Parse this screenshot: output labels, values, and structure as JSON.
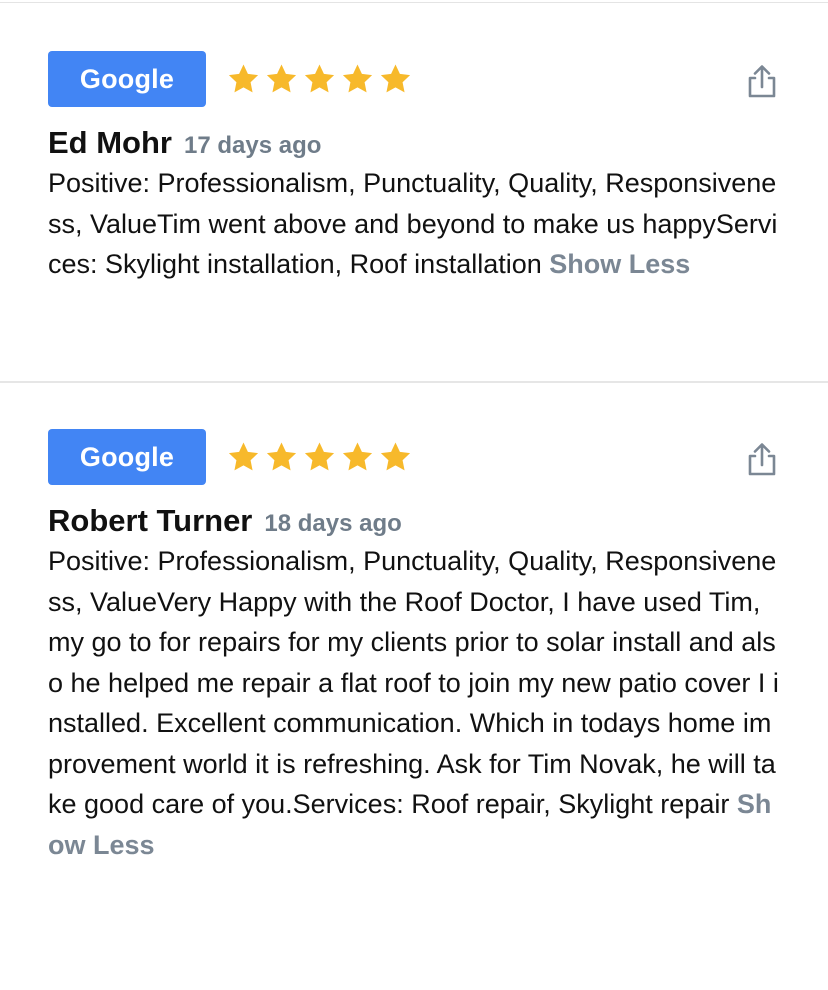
{
  "reviews": [
    {
      "source": "Google",
      "rating": 5,
      "author": "Ed Mohr",
      "time_ago": "17 days ago",
      "text": "Positive: Professionalism, Punctuality, Quality, Responsiveness, ValueTim went above and beyond to make us happyServices: Skylight installation, Roof installation",
      "toggle_label": "Show Less"
    },
    {
      "source": "Google",
      "rating": 5,
      "author": "Robert Turner",
      "time_ago": "18 days ago",
      "text": "Positive: Professionalism, Punctuality, Quality, Responsiveness, ValueVery Happy with the Roof Doctor, I have used Tim, my go to for repairs for my clients prior to solar install and also he helped me repair a flat roof to join my new patio cover I installed. Excellent communication. Which in todays home improvement world it is refreshing. Ask for Tim Novak, he will take good care of you.Services: Roof repair, Skylight repair",
      "toggle_label": "Show Less"
    }
  ],
  "colors": {
    "badge": "#4285f4",
    "star": "#f7b92b",
    "muted": "#6f7c89"
  },
  "icons": {
    "rating": "star-icon",
    "share": "share-icon"
  }
}
